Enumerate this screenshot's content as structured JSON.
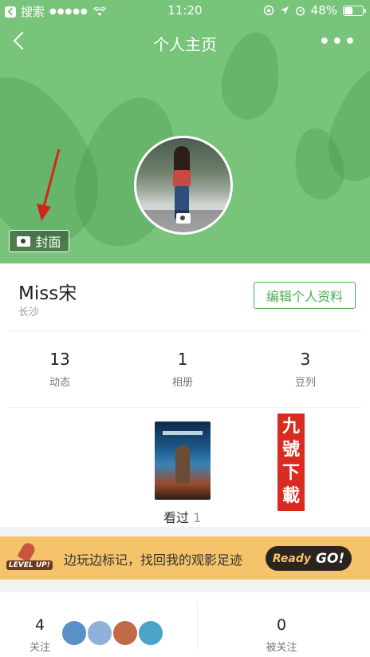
{
  "status_bar": {
    "back_app": "搜索",
    "signal": "●●●●●",
    "time": "11:20",
    "battery": "48%"
  },
  "navbar": {
    "title": "个人主页",
    "more": "•••"
  },
  "cover": {
    "label": "封面"
  },
  "profile": {
    "name": "Miss宋",
    "city": "长沙",
    "edit_label": "编辑个人资料"
  },
  "stats": [
    {
      "value": "13",
      "label": "动态"
    },
    {
      "value": "1",
      "label": "相册"
    },
    {
      "value": "3",
      "label": "豆列"
    }
  ],
  "seen": {
    "label": "看过",
    "count": "1"
  },
  "watermark": {
    "text": "九號下載"
  },
  "banner": {
    "badge": "LEVEL UP!",
    "text": "边玩边标记，找回我的观影足迹",
    "btn_ready": "Ready",
    "btn_go": "GO!"
  },
  "follow": {
    "following_count": "4",
    "following_label": "关注",
    "followers_count": "0",
    "followers_label": "被关注"
  },
  "colors": {
    "hero_green": "#78c47a",
    "accent_green": "#4caf50",
    "banner_yellow": "#f5c46a"
  }
}
